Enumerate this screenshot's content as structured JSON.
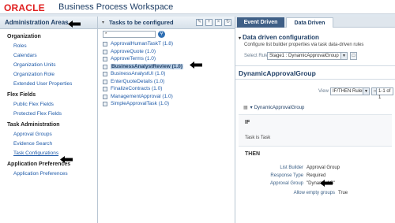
{
  "header": {
    "logo": "ORACLE",
    "title": "Business Process Workspace"
  },
  "left_panel": {
    "title": "Administration Areas",
    "sections": [
      {
        "label": "Organization",
        "items": [
          "Roles",
          "Calendars",
          "Organization Units",
          "Organization Role",
          "Extended User Properties"
        ]
      },
      {
        "label": "Flex Fields",
        "items": [
          "Public Flex Fields",
          "Protected Flex Fields"
        ]
      },
      {
        "label": "Task Administration",
        "items": [
          "Approval Groups",
          "Evidence Search",
          "Task Configurations"
        ]
      },
      {
        "label": "Application Preferences",
        "items": [
          "Application Preferences"
        ]
      }
    ],
    "selected_item": "Task Configurations"
  },
  "middle_panel": {
    "title": "Tasks to be configured",
    "search": {
      "value": "*",
      "placeholder": ""
    },
    "tasks": [
      "ApprovalHumanTaskT (1.8)",
      "ApproveQuote (1.0)",
      "ApproveTerms (1.0)",
      "BusinessAnalystReview (1.0)",
      "BusinessAnalystUI (1.0)",
      "EnterQuoteDetails (1.0)",
      "FinalizeContracts (1.0)",
      "ManagementApproval (1.0)",
      "SimpleApprovalTask (1.0)"
    ],
    "selected_task": "BusinessAnalystReview (1.0)"
  },
  "right_panel": {
    "tabs": [
      "Event Driven",
      "Data Driven"
    ],
    "active_tab": "Data Driven",
    "section_title": "Data driven configuration",
    "subtitle": "Configure list builder properties via task data-driven rules",
    "ruleset_label": "Select Ruleset",
    "ruleset_value": "Stage1 : DynamicApprovalGroup",
    "ruleset_name": "DynamicApprovalGroup",
    "view_label": "View",
    "view_value": "IF/THEN Rules",
    "pager": "1-1 of 1",
    "rule_name": "DynamicApprovalGroup",
    "if_keyword": "IF",
    "condition": "Task  is  Task",
    "then_keyword": "THEN",
    "actions": [
      {
        "key": "List Builder",
        "value": "Approval Group"
      },
      {
        "key": "Response Type",
        "value": "Required"
      },
      {
        "key": "Approval Group",
        "value": "\"DynamicAG\""
      },
      {
        "key": "Allow empty groups",
        "value": "True"
      }
    ]
  },
  "colors": {
    "brand_red": "#e01e1e",
    "title_blue": "#1f3f66",
    "link_blue": "#1e5aa8",
    "selection": "#b8cde3",
    "tab_dark": "#3f5f86"
  },
  "icons": [
    "pencil-icon",
    "add-icon",
    "delete-icon",
    "refresh-icon",
    "search-icon",
    "arrow-pointer-icon",
    "collapse-triangle-icon",
    "dropdown-arrow-icon"
  ]
}
